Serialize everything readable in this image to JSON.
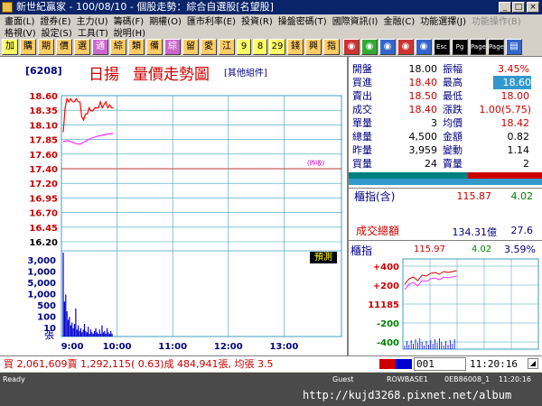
{
  "window": {
    "title": "新世紀贏家 - 100/08/10 - 個股走勢：綜合自選股[名望股]",
    "controls": [
      "_",
      "□",
      "×"
    ]
  },
  "menu": {
    "row1": [
      "畫面(L)",
      "證券(E)",
      "主力(U)",
      "籌碼(F)",
      "期權(O)",
      "匯市利率(E)",
      "投資(R)",
      "操盤密碼(T)",
      "國際資訊(I)",
      "金融(C)",
      "功能選擇(J)"
    ],
    "row1_disabled": "功能操作(B)",
    "row2": [
      "格視(V)",
      "設定(S)",
      "工具(T)",
      "說明(H)"
    ]
  },
  "toolbar": {
    "buttons": [
      "加",
      "購",
      "期",
      "價",
      "選",
      "通",
      "綜",
      "類",
      "備",
      "綜",
      "留",
      "愛",
      "江",
      "9",
      "8",
      "29",
      "錢",
      "興",
      "指"
    ],
    "nav_buttons": [
      "Esc",
      "Pg",
      "Page",
      "Page"
    ]
  },
  "stock": {
    "code": "[6208]",
    "name": "日揚",
    "chart_title": "量價走勢圖",
    "component_label": "[其他組件]",
    "prev_close_tag": "(昨收)",
    "forecast_label": "預測"
  },
  "quote": {
    "open_label": "開盤",
    "open": "18.00",
    "amplitude_label": "振幅",
    "amplitude": "3.45%",
    "bid_label": "買進",
    "bid": "18.40",
    "high_label": "最高",
    "high": "18.60",
    "ask_label": "賣出",
    "ask": "18.50",
    "low_label": "最低",
    "low": "18.00",
    "last_label": "成交",
    "last": "18.40",
    "change_label": "漲跌",
    "change": "1.00(5.75)",
    "lot_label": "單量",
    "lot": "3",
    "avg_label": "均價",
    "avg": "18.42",
    "total_vol_label": "總量",
    "total_vol": "4,500",
    "amount_label": "金額",
    "amount": "0.82",
    "prev_vol_label": "昨量",
    "prev_vol": "3,959",
    "var_label": "變動",
    "var": "1.14",
    "buy_vol_label": "買量",
    "buy_vol": "24",
    "sell_vol_label": "賣量",
    "sell_vol": "2"
  },
  "index": {
    "label": "櫃指(含)",
    "value": "115.87",
    "change": "4.02",
    "turnover_label": "成交總額",
    "turnover": "134.31億",
    "turnover_change": "27.6",
    "mini_label": "櫃指",
    "mini_value": "115.97",
    "mini_change": "4.02",
    "mini_pct": "3.59%",
    "mini_ticks": [
      "+400",
      "+200",
      "11185",
      "-200",
      "-400"
    ]
  },
  "chart_data": [
    {
      "type": "line",
      "y_ticks": [
        "18.60",
        "18.35",
        "18.10",
        "17.85",
        "17.60",
        "17.40",
        "17.20",
        "16.95",
        "16.70",
        "16.45",
        "16.20"
      ],
      "y_ticks_vol": [
        "3,000",
        "1,000",
        "5,000",
        "1,000",
        "500",
        "100",
        "10"
      ],
      "vol_unit": "張",
      "x_ticks": [
        "9:00",
        "10:00",
        "11:00",
        "12:00",
        "13:00"
      ],
      "ylim": [
        16.2,
        18.6
      ],
      "prev_close": 17.4,
      "series": [
        {
          "color": "#ff0000",
          "x": [
            0,
            2,
            4,
            6,
            8,
            10,
            12,
            14,
            16,
            18,
            20,
            22,
            24,
            26,
            28,
            30,
            32,
            34,
            36,
            38,
            40,
            42,
            44,
            46,
            48,
            50,
            52,
            54
          ],
          "values": [
            18.0,
            18.4,
            18.55,
            18.5,
            18.55,
            18.5,
            18.5,
            18.55,
            18.5,
            18.5,
            18.25,
            18.2,
            18.3,
            18.3,
            18.4,
            18.35,
            18.35,
            18.4,
            18.4,
            18.4,
            18.5,
            18.4,
            18.45,
            18.5,
            18.4,
            18.45,
            18.4,
            18.4
          ]
        },
        {
          "color": "#ff00ff",
          "x": [
            0,
            6,
            12,
            18,
            24,
            30,
            36,
            42,
            48,
            54
          ],
          "values": [
            17.85,
            17.86,
            17.82,
            17.8,
            17.85,
            17.9,
            17.93,
            17.95,
            17.97,
            17.98
          ]
        }
      ],
      "volume": [
        60,
        25,
        30,
        18,
        12,
        14,
        8,
        10,
        6,
        9,
        20,
        5,
        8,
        4,
        6,
        3,
        5,
        9,
        4,
        3,
        7,
        2,
        5,
        3,
        2,
        4,
        6,
        3,
        2,
        5,
        2,
        8,
        3,
        4,
        2,
        6,
        3,
        2,
        4,
        2
      ]
    }
  ],
  "bottom": {
    "summary": "買 2,061,609賣 1,292,115( 0.63)成 484,941張, 均張 3.5",
    "code_box": "001",
    "clock": "11:20:16"
  },
  "status": {
    "ready": "Ready",
    "guest": "Guest",
    "rows": "ROWBASE1",
    "watch": "0EB86008_1",
    "time": "11:20:16",
    "url": "http://kujd3268.pixnet.net/album"
  },
  "colors": {
    "title_bg": "#0a246a",
    "chart_bg": "#ffffff",
    "price_line": "#ff0000",
    "avg_line": "#ff00ff",
    "volume": "#0000cc",
    "grid": "#3c9fbf"
  }
}
